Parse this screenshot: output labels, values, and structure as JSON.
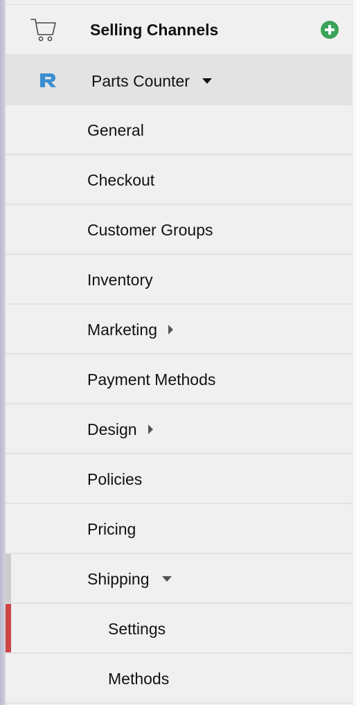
{
  "header": {
    "title": "Selling Channels",
    "cart_icon": "shopping-cart-icon",
    "add_icon": "plus-circle-icon",
    "add_color": "#3aa35a"
  },
  "channel": {
    "label": "Parts Counter",
    "logo_icon": "r-logo-icon",
    "logo_color": "#3b8fd0"
  },
  "menu": {
    "items": [
      {
        "label": "General"
      },
      {
        "label": "Checkout"
      },
      {
        "label": "Customer Groups"
      },
      {
        "label": "Inventory"
      },
      {
        "label": "Marketing",
        "submenu": "collapsed"
      },
      {
        "label": "Payment Methods"
      },
      {
        "label": "Design",
        "submenu": "collapsed"
      },
      {
        "label": "Policies"
      },
      {
        "label": "Pricing"
      },
      {
        "label": "Shipping",
        "submenu": "expanded"
      }
    ],
    "shipping_subitems": [
      {
        "label": "Settings",
        "active": true
      },
      {
        "label": "Methods"
      }
    ]
  },
  "colors": {
    "active_indicator": "#cc4444",
    "expanded_indicator": "#cccccc",
    "selected_channel_bg": "#e3e3e3"
  }
}
